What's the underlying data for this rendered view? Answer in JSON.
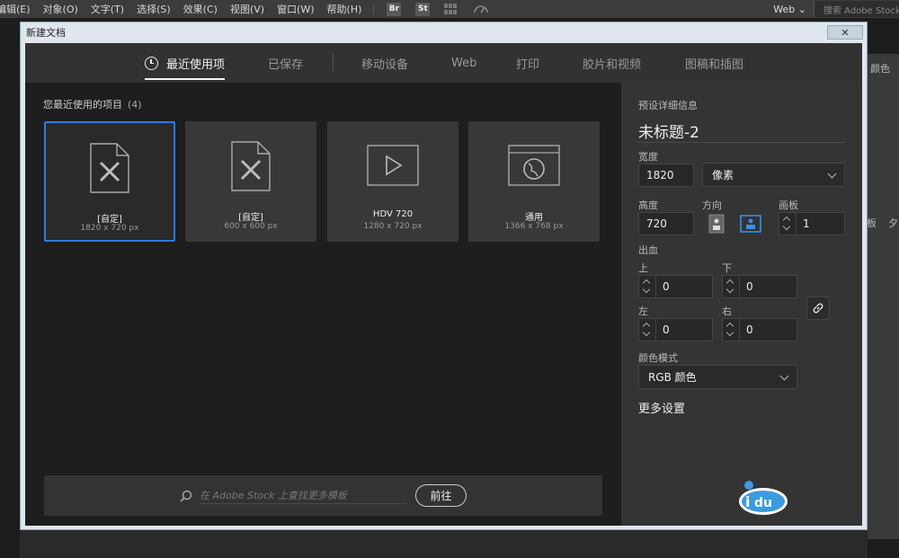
{
  "menubar": {
    "items": [
      "编辑(E)",
      "对象(O)",
      "文字(T)",
      "选择(S)",
      "效果(C)",
      "视图(V)",
      "窗口(W)",
      "帮助(H)"
    ],
    "app_chips": [
      "Br",
      "St"
    ],
    "workspace": "Web",
    "search_placeholder": "搜索 Adobe Stock"
  },
  "background_panel": {
    "labels": [
      "色",
      "颜色",
      "板",
      "夕"
    ]
  },
  "dialog": {
    "title": "新建文档",
    "close_label": "✕",
    "tabs": [
      "最近使用项",
      "已保存",
      "移动设备",
      "Web",
      "打印",
      "胶片和视频",
      "图稿和插图"
    ],
    "active_tab": 0,
    "recent": {
      "heading": "您最近使用的项目",
      "count": "(4)",
      "items": [
        {
          "name": "[自定]",
          "size": "1820 x 720 px",
          "icon": "document-pencil-icon",
          "selected": true
        },
        {
          "name": "[自定]",
          "size": "600 x 600 px",
          "icon": "document-pencil-icon",
          "selected": false
        },
        {
          "name": "HDV 720",
          "size": "1280 x 720 px",
          "icon": "video-play-icon",
          "selected": false
        },
        {
          "name": "通用",
          "size": "1366 x 768 px",
          "icon": "browser-globe-icon",
          "selected": false
        }
      ]
    },
    "stock": {
      "placeholder": "在 Adobe Stock 上查找更多模板",
      "go_label": "前往"
    },
    "details": {
      "section_label": "预设详细信息",
      "doc_name": "未标题-2",
      "width_label": "宽度",
      "width_value": "1820",
      "unit": "像素",
      "height_label": "高度",
      "height_value": "720",
      "orientation_label": "方向",
      "artboards_label": "画板",
      "artboards_value": "1",
      "bleed_label": "出血",
      "top_label": "上",
      "top_value": "0",
      "bottom_label": "下",
      "bottom_value": "0",
      "left_label": "左",
      "left_value": "0",
      "right_label": "右",
      "right_value": "0",
      "color_mode_label": "颜色模式",
      "color_mode_value": "RGB 颜色",
      "more_settings": "更多设置"
    }
  },
  "colors": {
    "accent": "#2d7be0",
    "orientation_active": "#3a8ee6"
  }
}
